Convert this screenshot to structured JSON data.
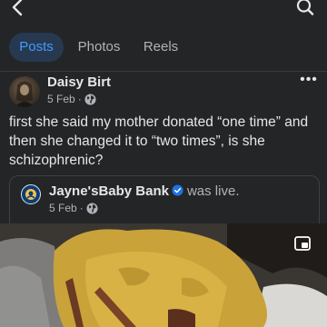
{
  "nav": {
    "tabs": [
      {
        "label": "Posts",
        "active": true
      },
      {
        "label": "Photos",
        "active": false
      },
      {
        "label": "Reels",
        "active": false
      }
    ]
  },
  "post": {
    "author": "Daisy Birt",
    "date": "5 Feb",
    "separator": "·",
    "more": "•••",
    "text": "first she said my mother donated “one time” and then she changed it to “two times”, is she schizophrenic?"
  },
  "shared": {
    "page_name": "Jayne'sBaby Bank",
    "action": "was live.",
    "date": "5 Feb",
    "separator": "·"
  },
  "colors": {
    "background": "#242526",
    "accent": "#4599ff",
    "active_tab_bg": "#263951",
    "secondary_text": "#b0b3b8",
    "verified": "#1b74e4"
  },
  "icons": {
    "back": "back-arrow-icon",
    "search": "search-icon",
    "globe": "globe-icon",
    "verified": "verified-badge-icon",
    "pip": "picture-in-picture-icon"
  }
}
